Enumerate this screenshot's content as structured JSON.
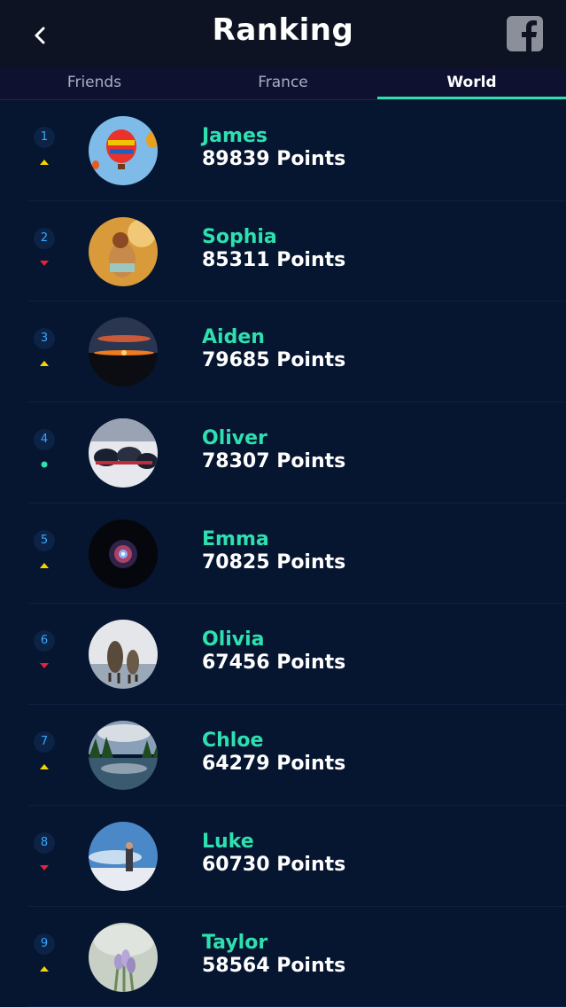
{
  "header": {
    "title": "Ranking",
    "back_icon": "chevron-left-icon",
    "share_icon": "facebook-icon"
  },
  "tabs": [
    {
      "label": "Friends",
      "active": false
    },
    {
      "label": "France",
      "active": false
    },
    {
      "label": "World",
      "active": true
    }
  ],
  "colors": {
    "background": "#061530",
    "accent": "#2ee0b0",
    "trend_up": "#f5d400",
    "trend_down": "#e8203a",
    "trend_same": "#2ee0b0",
    "rank_text": "#37a7ff"
  },
  "players": [
    {
      "rank": "1",
      "name": "James",
      "points": "89839 Points",
      "trend": "up"
    },
    {
      "rank": "2",
      "name": "Sophia",
      "points": "85311 Points",
      "trend": "down"
    },
    {
      "rank": "3",
      "name": "Aiden",
      "points": "79685 Points",
      "trend": "up"
    },
    {
      "rank": "4",
      "name": "Oliver",
      "points": "78307 Points",
      "trend": "same"
    },
    {
      "rank": "5",
      "name": "Emma",
      "points": "70825 Points",
      "trend": "up"
    },
    {
      "rank": "6",
      "name": "Olivia",
      "points": "67456 Points",
      "trend": "down"
    },
    {
      "rank": "7",
      "name": "Chloe",
      "points": "64279 Points",
      "trend": "up"
    },
    {
      "rank": "8",
      "name": "Luke",
      "points": "60730 Points",
      "trend": "down"
    },
    {
      "rank": "9",
      "name": "Taylor",
      "points": "58564 Points",
      "trend": "up"
    }
  ]
}
